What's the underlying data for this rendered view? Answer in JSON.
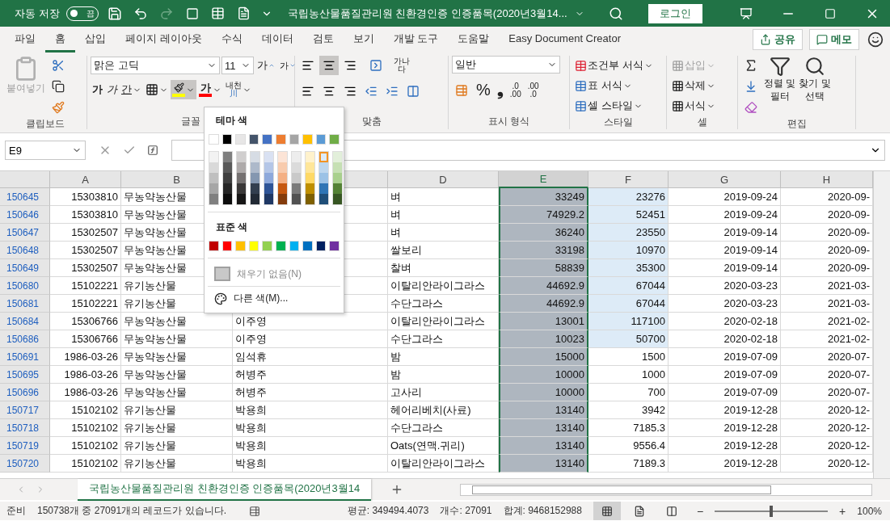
{
  "title_bar": {
    "autosave_label": "자동 저장",
    "autosave": {
      "on": false,
      "label": "끔"
    },
    "title": "국립농산물품질관리원 친환경인증 인증품목(2020년3월14...",
    "login": "로그인"
  },
  "tabs": [
    {
      "label": "파일",
      "selected": false
    },
    {
      "label": "홈",
      "selected": true
    },
    {
      "label": "삽입",
      "selected": false
    },
    {
      "label": "페이지 레이아웃",
      "selected": false
    },
    {
      "label": "수식",
      "selected": false
    },
    {
      "label": "데이터",
      "selected": false
    },
    {
      "label": "검토",
      "selected": false
    },
    {
      "label": "보기",
      "selected": false
    },
    {
      "label": "개발 도구",
      "selected": false
    },
    {
      "label": "도움말",
      "selected": false
    },
    {
      "label": "Easy Document Creator",
      "selected": false
    }
  ],
  "share": "공유",
  "memo": "메모",
  "ribbon": {
    "clipboard": {
      "paste": "붙여넣기",
      "label": "클립보드"
    },
    "font": {
      "face": "맑은 고딕",
      "size": "11",
      "grow": "가",
      "shrink": "가",
      "bold": "가",
      "italic": "가",
      "underline": "간",
      "font_color": "가",
      "phonetic": "내천",
      "phonetic_sub": "川",
      "label": "글꼴"
    },
    "alignment": {
      "wrap_top": "가나",
      "wrap_bottom": "다",
      "label": "맞춤"
    },
    "number": {
      "format": "일반",
      "percent": "%",
      "comma": "❟",
      "inc_decimal": [
        ".0",
        ".00"
      ],
      "dec_decimal": [
        ".00",
        ".0"
      ],
      "label": "표시 형식"
    },
    "styles": {
      "items": [
        "조건부 서식",
        "표 서식",
        "셀 스타일"
      ],
      "label": "스타일"
    },
    "cells": {
      "items": [
        {
          "label": "삽입",
          "disabled": true
        },
        {
          "label": "삭제",
          "disabled": false
        },
        {
          "label": "서식",
          "disabled": false
        }
      ],
      "label": "셀"
    },
    "editing": {
      "sort": [
        "정렬 및",
        "필터"
      ],
      "find": [
        "찾기 및",
        "선택"
      ],
      "label": "편집"
    }
  },
  "formula_bar": {
    "name_box": "E9"
  },
  "columns": [
    {
      "label": "A",
      "selected": false
    },
    {
      "label": "B",
      "selected": false
    },
    {
      "selected": false
    },
    {
      "label": "D",
      "selected": false
    },
    {
      "label": "E",
      "selected": true
    },
    {
      "label": "F",
      "selected": false
    },
    {
      "label": "G",
      "selected": false
    },
    {
      "label": "H",
      "selected": false
    }
  ],
  "rows": [
    {
      "header": "150645",
      "cells": [
        "15303810",
        "무농약농산물",
        null,
        "벼",
        "33249",
        "23276",
        "2019-09-24",
        "2020-09-"
      ],
      "highlight_f": true
    },
    {
      "header": "150646",
      "cells": [
        "15303810",
        "무농약농산물",
        null,
        "벼",
        "74929.2",
        "52451",
        "2019-09-24",
        "2020-09-"
      ],
      "highlight_f": true
    },
    {
      "header": "150647",
      "cells": [
        "15302507",
        "무농약농산물",
        null,
        "벼",
        "36240",
        "23550",
        "2019-09-14",
        "2020-09-"
      ],
      "highlight_f": true
    },
    {
      "header": "150648",
      "cells": [
        "15302507",
        "무농약농산물",
        null,
        "쌀보리",
        "33198",
        "10970",
        "2019-09-14",
        "2020-09-"
      ],
      "highlight_f": true
    },
    {
      "header": "150649",
      "cells": [
        "15302507",
        "무농약농산물",
        null,
        "찰벼",
        "58839",
        "35300",
        "2019-09-14",
        "2020-09-"
      ],
      "highlight_f": true
    },
    {
      "header": "150680",
      "cells": [
        "15102221",
        "유기농산물",
        null,
        "이탈리안라이그라스",
        "44692.9",
        "67044",
        "2020-03-23",
        "2021-03-"
      ],
      "highlight_f": true
    },
    {
      "header": "150681",
      "cells": [
        "15102221",
        "유기농산물",
        null,
        "수단그라스",
        "44692.9",
        "67044",
        "2020-03-23",
        "2021-03-"
      ],
      "highlight_f": true
    },
    {
      "header": "150684",
      "cells": [
        "15306766",
        "무농약농산물",
        "이주영",
        "이탈리안라이그라스",
        "13001",
        "117100",
        "2020-02-18",
        "2021-02-"
      ],
      "highlight_f": true
    },
    {
      "header": "150686",
      "cells": [
        "15306766",
        "무농약농산물",
        "이주영",
        "수단그라스",
        "10023",
        "50700",
        "2020-02-18",
        "2021-02-"
      ],
      "highlight_f": true
    },
    {
      "header": "150691",
      "cells": [
        "1986-03-26",
        "무농약농산물",
        "임석휴",
        "밤",
        "15000",
        "1500",
        "2019-07-09",
        "2020-07-"
      ],
      "highlight_f": false
    },
    {
      "header": "150695",
      "cells": [
        "1986-03-26",
        "무농약농산물",
        "허병주",
        "밤",
        "10000",
        "1000",
        "2019-07-09",
        "2020-07-"
      ],
      "highlight_f": false
    },
    {
      "header": "150696",
      "cells": [
        "1986-03-26",
        "무농약농산물",
        "허병주",
        "고사리",
        "10000",
        "700",
        "2019-07-09",
        "2020-07-"
      ],
      "highlight_f": false
    },
    {
      "header": "150717",
      "cells": [
        "15102102",
        "유기농산물",
        "박용희",
        "헤어리베치(사료)",
        "13140",
        "3942",
        "2019-12-28",
        "2020-12-"
      ],
      "highlight_f": false
    },
    {
      "header": "150718",
      "cells": [
        "15102102",
        "유기농산물",
        "박용희",
        "수단그라스",
        "13140",
        "7185.3",
        "2019-12-28",
        "2020-12-"
      ],
      "highlight_f": false
    },
    {
      "header": "150719",
      "cells": [
        "15102102",
        "유기농산물",
        "박용희",
        "Oats(연맥.귀리)",
        "13140",
        "9556.4",
        "2019-12-28",
        "2020-12-"
      ],
      "highlight_f": false
    },
    {
      "header": "150720",
      "cells": [
        "15102102",
        "유기농산물",
        "박용희",
        "이탈리안라이그라스",
        "13140",
        "7189.3",
        "2019-12-28",
        "2020-12-"
      ],
      "highlight_f": false
    }
  ],
  "color_menu": {
    "theme_title": "테마 색",
    "theme": [
      {
        "color": "#ffffff",
        "selected": false
      },
      {
        "color": "#000000",
        "selected": false
      },
      {
        "color": "#e7e6e6",
        "selected": false
      },
      {
        "color": "#44546a",
        "selected": false
      },
      {
        "color": "#4472c4",
        "selected": false
      },
      {
        "color": "#ed7d31",
        "selected": false
      },
      {
        "color": "#a5a5a5",
        "selected": false
      },
      {
        "color": "#ffc000",
        "selected": false
      },
      {
        "color": "#5b9bd5",
        "selected": false
      },
      {
        "color": "#70ad47",
        "selected": false
      }
    ],
    "shades": [
      [
        {
          "color": "#f2f2f2",
          "selected": false
        },
        {
          "color": "#d9d9d9",
          "selected": false
        },
        {
          "color": "#bfbfbf",
          "selected": false
        },
        {
          "color": "#a6a6a6",
          "selected": false
        },
        {
          "color": "#808080",
          "selected": false
        }
      ],
      [
        {
          "color": "#7f7f7f",
          "selected": false
        },
        {
          "color": "#595959",
          "selected": false
        },
        {
          "color": "#3f3f3f",
          "selected": false
        },
        {
          "color": "#262626",
          "selected": false
        },
        {
          "color": "#0d0d0d",
          "selected": false
        }
      ],
      [
        {
          "color": "#d0cece",
          "selected": false
        },
        {
          "color": "#aeaaaa",
          "selected": false
        },
        {
          "color": "#757171",
          "selected": false
        },
        {
          "color": "#3a3838",
          "selected": false
        },
        {
          "color": "#171616",
          "selected": false
        }
      ],
      [
        {
          "color": "#d6dce4",
          "selected": false
        },
        {
          "color": "#adb9ca",
          "selected": false
        },
        {
          "color": "#8497b0",
          "selected": false
        },
        {
          "color": "#333f4f",
          "selected": false
        },
        {
          "color": "#222a35",
          "selected": false
        }
      ],
      [
        {
          "color": "#d9e1f2",
          "selected": false
        },
        {
          "color": "#b4c6e7",
          "selected": false
        },
        {
          "color": "#8ea9db",
          "selected": false
        },
        {
          "color": "#2f5597",
          "selected": false
        },
        {
          "color": "#1f3864",
          "selected": false
        }
      ],
      [
        {
          "color": "#fce4d6",
          "selected": false
        },
        {
          "color": "#f8cbad",
          "selected": false
        },
        {
          "color": "#f4b084",
          "selected": false
        },
        {
          "color": "#c65911",
          "selected": false
        },
        {
          "color": "#843c0c",
          "selected": false
        }
      ],
      [
        {
          "color": "#ededed",
          "selected": false
        },
        {
          "color": "#dbdbdb",
          "selected": false
        },
        {
          "color": "#c9c9c9",
          "selected": false
        },
        {
          "color": "#7b7b7b",
          "selected": false
        },
        {
          "color": "#525252",
          "selected": false
        }
      ],
      [
        {
          "color": "#fff2cc",
          "selected": false
        },
        {
          "color": "#ffe699",
          "selected": false
        },
        {
          "color": "#ffd966",
          "selected": false
        },
        {
          "color": "#bf8f00",
          "selected": false
        },
        {
          "color": "#7f6000",
          "selected": false
        }
      ],
      [
        {
          "color": "#ddebf7",
          "selected": true
        },
        {
          "color": "#bdd7ee",
          "selected": false
        },
        {
          "color": "#9bc2e6",
          "selected": false
        },
        {
          "color": "#2f75b5",
          "selected": false
        },
        {
          "color": "#1f4e78",
          "selected": false
        }
      ],
      [
        {
          "color": "#e2efda",
          "selected": false
        },
        {
          "color": "#c6e0b4",
          "selected": false
        },
        {
          "color": "#a9d08e",
          "selected": false
        },
        {
          "color": "#548235",
          "selected": false
        },
        {
          "color": "#375623",
          "selected": false
        }
      ]
    ],
    "standard_title": "표준 색",
    "standard": [
      {
        "color": "#c00000",
        "selected": false
      },
      {
        "color": "#ff0000",
        "selected": false
      },
      {
        "color": "#ffc000",
        "selected": false
      },
      {
        "color": "#ffff00",
        "selected": false
      },
      {
        "color": "#92d050",
        "selected": false
      },
      {
        "color": "#00b050",
        "selected": false
      },
      {
        "color": "#00b0f0",
        "selected": false
      },
      {
        "color": "#0070c0",
        "selected": false
      },
      {
        "color": "#002060",
        "selected": false
      },
      {
        "color": "#7030a0",
        "selected": false
      }
    ],
    "no_fill": {
      "label": "채우기 없음(N)",
      "disabled": true
    },
    "more": "다른 색(M)..."
  },
  "sheet_tabs": [
    {
      "label": "국립농산물품질관리원 친환경인증 인증품목(2020년3월14",
      "selected": true
    }
  ],
  "status_bar": {
    "ready": "준비",
    "records": "150738개 중 27091개의 레코드가 있습니다.",
    "average": "평균: 349494.4073",
    "count": "개수: 27091",
    "sum": "합계: 9468152988",
    "views": [
      {
        "kind": "normal",
        "selected": true
      },
      {
        "kind": "layout",
        "selected": false
      },
      {
        "kind": "pagebreak",
        "selected": false
      }
    ],
    "minus": "−",
    "plus": "+",
    "zoom": {
      "level": 0.5
    },
    "zoom_label": "100%"
  }
}
